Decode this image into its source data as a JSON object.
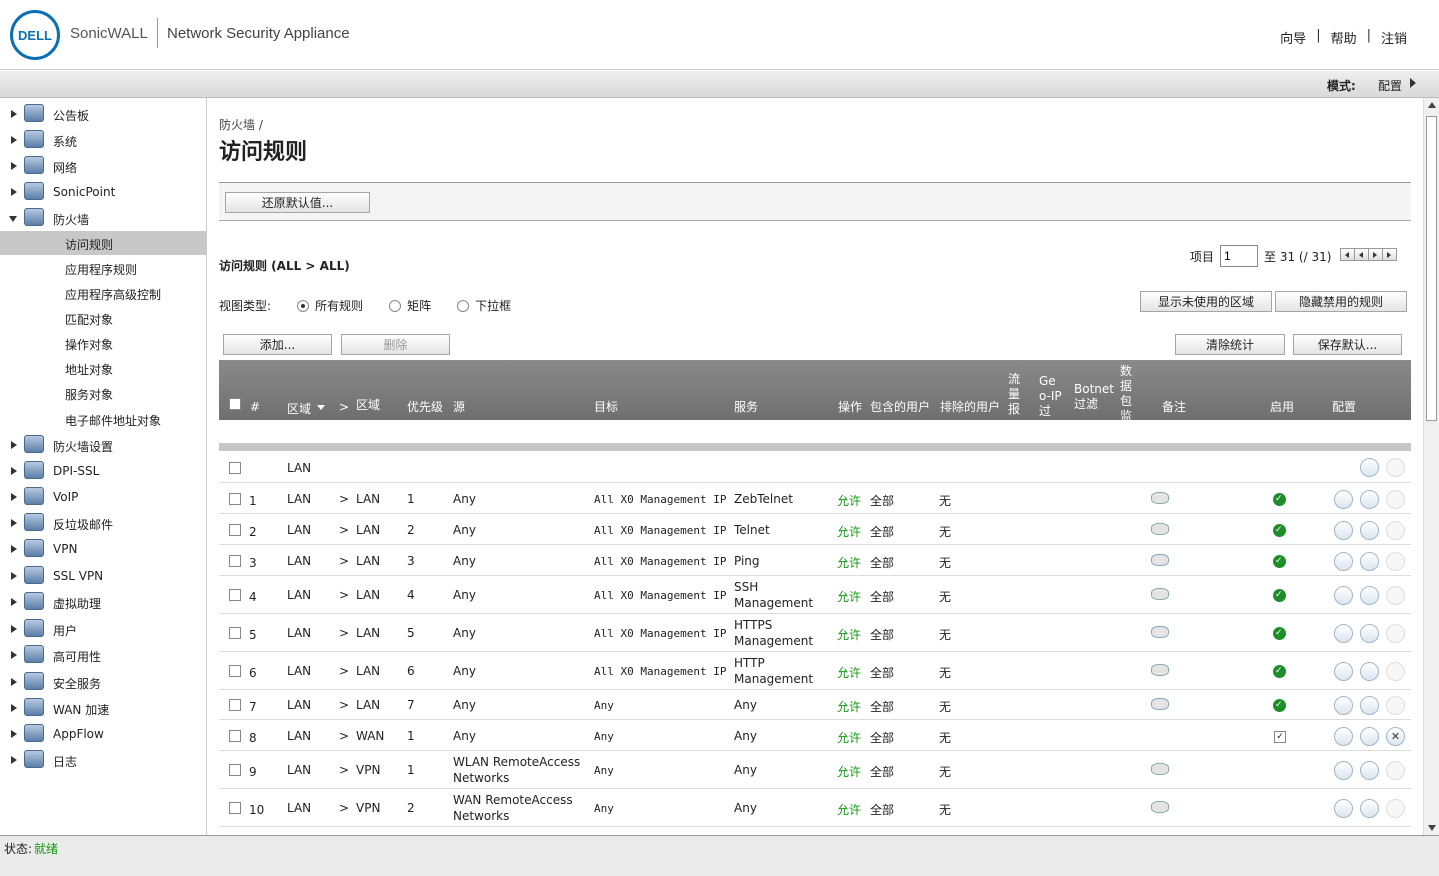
{
  "header": {
    "logo_text": "DELL",
    "brand": "SonicWALL",
    "product": "Network Security Appliance",
    "links": [
      "向导",
      "帮助",
      "注销"
    ]
  },
  "mode": {
    "label": "模式:",
    "value": "配置"
  },
  "sidebar": {
    "items": [
      {
        "label": "公告板",
        "icon": "dashboard-icon"
      },
      {
        "label": "系统",
        "icon": "monitor-icon"
      },
      {
        "label": "网络",
        "icon": "globe-icon"
      },
      {
        "label": "SonicPoint",
        "icon": "access-point-icon"
      },
      {
        "label": "防火墙",
        "icon": "firewall-icon",
        "open": true
      },
      {
        "label": "防火墙设置",
        "icon": "firewall-settings-icon"
      },
      {
        "label": "DPI-SSL",
        "icon": "lock-icon"
      },
      {
        "label": "VoIP",
        "icon": "headset-icon"
      },
      {
        "label": "反垃圾邮件",
        "icon": "mail-icon"
      },
      {
        "label": "VPN",
        "icon": "vpn-lock-icon"
      },
      {
        "label": "SSL VPN",
        "icon": "ssl-vpn-icon"
      },
      {
        "label": "虚拟助理",
        "icon": "assistant-icon"
      },
      {
        "label": "用户",
        "icon": "users-icon"
      },
      {
        "label": "高可用性",
        "icon": "high-availability-icon"
      },
      {
        "label": "安全服务",
        "icon": "shield-icon"
      },
      {
        "label": "WAN 加速",
        "icon": "wan-accel-icon"
      },
      {
        "label": "AppFlow",
        "icon": "appflow-icon"
      },
      {
        "label": "日志",
        "icon": "log-icon"
      }
    ],
    "subitems": [
      "访问规则",
      "应用程序规则",
      "应用程序高级控制",
      "匹配对象",
      "操作对象",
      "地址对象",
      "服务对象",
      "电子邮件地址对象"
    ]
  },
  "main": {
    "breadcrumb": "防火墙 /",
    "title": "访问规则",
    "restore_button": "还原默认值...",
    "section_title": "访问规则 (ALL > ALL)",
    "pager": {
      "label": "项目",
      "value": "1",
      "range": "至 31 (/ 31)"
    },
    "view": {
      "label": "视图类型:",
      "options": [
        "所有规则",
        "矩阵",
        "下拉框"
      ],
      "selected": "所有规则"
    },
    "buttons": {
      "show_unused": "显示未使用的区域",
      "hide_disabled": "隐藏禁用的规则",
      "add": "添加...",
      "delete": "删除",
      "clear_stats": "清除统计",
      "save_default": "保存默认..."
    },
    "columns": {
      "num": "#",
      "zone_from": "区域",
      "arrow": ">",
      "zone_to": "区域",
      "priority": "优先级",
      "source": "源",
      "dest": "目标",
      "service": "服务",
      "action": "操作",
      "users_incl": "包含的用户",
      "users_excl": "排除的用户",
      "traffic": "流量报",
      "geoip": "Geo-IP过",
      "botnet": "Botnet过滤",
      "packet": "数据包监",
      "comment": "备注",
      "enable": "启用",
      "config": "配置"
    },
    "group_label": "LAN",
    "rows": [
      {
        "num": "1",
        "from": "LAN",
        "to": "LAN",
        "pri": "1",
        "src": [
          "Any"
        ],
        "dst": "All X0 Management IP",
        "svc": [
          "ZebTelnet"
        ],
        "action": "允许",
        "incl": "全部",
        "excl": "无",
        "comment": true,
        "enabled": "green"
      },
      {
        "num": "2",
        "from": "LAN",
        "to": "LAN",
        "pri": "2",
        "src": [
          "Any"
        ],
        "dst": "All X0 Management IP",
        "svc": [
          "Telnet"
        ],
        "action": "允许",
        "incl": "全部",
        "excl": "无",
        "comment": true,
        "enabled": "green"
      },
      {
        "num": "3",
        "from": "LAN",
        "to": "LAN",
        "pri": "3",
        "src": [
          "Any"
        ],
        "dst": "All X0 Management IP",
        "svc": [
          "Ping"
        ],
        "action": "允许",
        "incl": "全部",
        "excl": "无",
        "comment": true,
        "enabled": "green"
      },
      {
        "num": "4",
        "from": "LAN",
        "to": "LAN",
        "pri": "4",
        "src": [
          "Any"
        ],
        "dst": "All X0 Management IP",
        "svc": [
          "SSH",
          "Management"
        ],
        "action": "允许",
        "incl": "全部",
        "excl": "无",
        "comment": true,
        "enabled": "green"
      },
      {
        "num": "5",
        "from": "LAN",
        "to": "LAN",
        "pri": "5",
        "src": [
          "Any"
        ],
        "dst": "All X0 Management IP",
        "svc": [
          "HTTPS",
          "Management"
        ],
        "action": "允许",
        "incl": "全部",
        "excl": "无",
        "comment": true,
        "enabled": "green"
      },
      {
        "num": "6",
        "from": "LAN",
        "to": "LAN",
        "pri": "6",
        "src": [
          "Any"
        ],
        "dst": "All X0 Management IP",
        "svc": [
          "HTTP",
          "Management"
        ],
        "action": "允许",
        "incl": "全部",
        "excl": "无",
        "comment": true,
        "enabled": "green"
      },
      {
        "num": "7",
        "from": "LAN",
        "to": "LAN",
        "pri": "7",
        "src": [
          "Any"
        ],
        "dst": "Any",
        "svc": [
          "Any"
        ],
        "action": "允许",
        "incl": "全部",
        "excl": "无",
        "comment": true,
        "enabled": "green"
      },
      {
        "num": "8",
        "from": "LAN",
        "to": "WAN",
        "pri": "1",
        "src": [
          "Any"
        ],
        "dst": "Any",
        "svc": [
          "Any"
        ],
        "action": "允许",
        "incl": "全部",
        "excl": "无",
        "comment": false,
        "enabled": "checkbox"
      },
      {
        "num": "9",
        "from": "LAN",
        "to": "VPN",
        "pri": "1",
        "src": [
          "WLAN RemoteAccess",
          "Networks"
        ],
        "dst": "Any",
        "svc": [
          "Any"
        ],
        "action": "允许",
        "incl": "全部",
        "excl": "无",
        "comment": true,
        "enabled": "none"
      },
      {
        "num": "10",
        "from": "LAN",
        "to": "VPN",
        "pri": "2",
        "src": [
          "WAN RemoteAccess",
          "Networks"
        ],
        "dst": "Any",
        "svc": [
          "Any"
        ],
        "action": "允许",
        "incl": "全部",
        "excl": "无",
        "comment": true,
        "enabled": "none"
      }
    ]
  },
  "status": {
    "label": "状态:",
    "value": "就绪",
    "value_color": "#119911"
  }
}
